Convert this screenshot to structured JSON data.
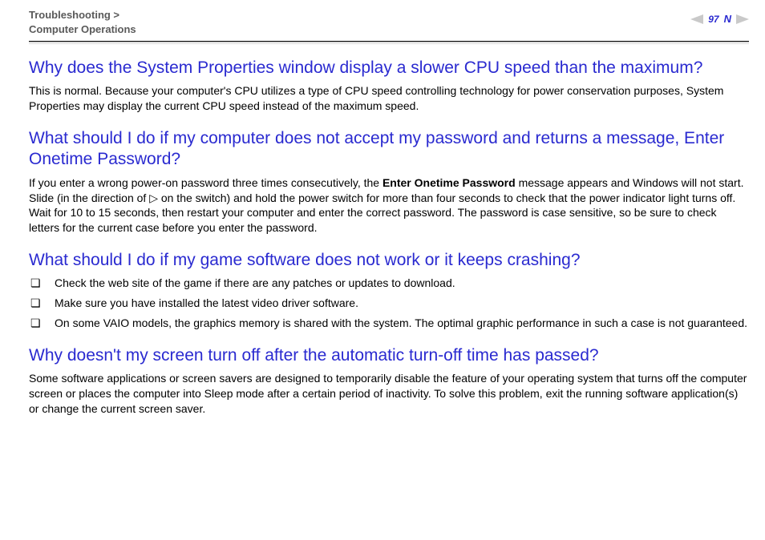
{
  "header": {
    "breadcrumb_line1": "Troubleshooting >",
    "breadcrumb_line2": "Computer Operations",
    "page_number": "97"
  },
  "sections": [
    {
      "heading": "Why does the System Properties window display a slower CPU speed than the maximum?",
      "paragraph": "This is normal. Because your computer's CPU utilizes a type of CPU speed controlling technology for power conservation purposes, System Properties may display the current CPU speed instead of the maximum speed."
    },
    {
      "heading": "What should I do if my computer does not accept my password and returns a message, Enter Onetime Password?",
      "paragraph_pre": "If you enter a wrong power-on password three times consecutively, the ",
      "paragraph_bold": "Enter Onetime Password",
      "paragraph_post": " message appears and Windows will not start. Slide (in the direction of ▷ on the switch) and hold the power switch for more than four seconds to check that the power indicator light turns off. Wait for 10 to 15 seconds, then restart your computer and enter the correct password. The password is case sensitive, so be sure to check letters for the current case before you enter the password."
    },
    {
      "heading": "What should I do if my game software does not work or it keeps crashing?",
      "bullets": [
        "Check the web site of the game if there are any patches or updates to download.",
        "Make sure you have installed the latest video driver software.",
        "On some VAIO models, the graphics memory is shared with the system. The optimal graphic performance in such a case is not guaranteed."
      ]
    },
    {
      "heading": "Why doesn't my screen turn off after the automatic turn-off time has passed?",
      "paragraph": "Some software applications or screen savers are designed to temporarily disable the feature of your operating system that turns off the computer screen or places the computer into Sleep mode after a certain period of inactivity. To solve this problem, exit the running software application(s) or change the current screen saver."
    }
  ]
}
